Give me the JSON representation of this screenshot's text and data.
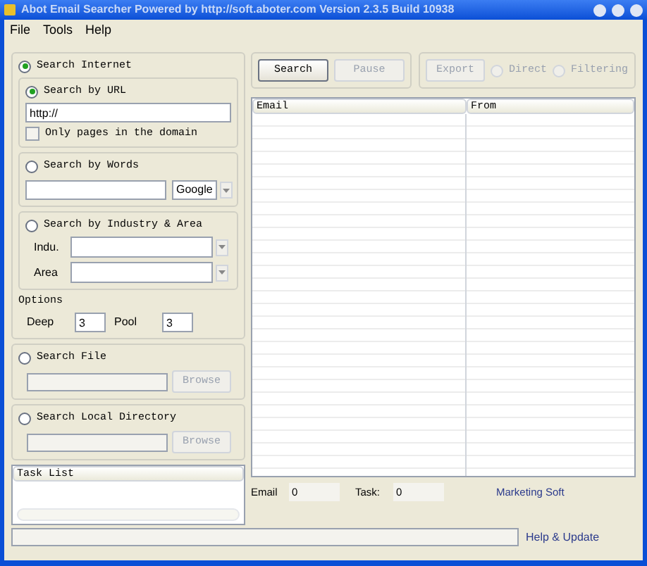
{
  "window": {
    "title": "Abot Email Searcher Powered by http://soft.aboter.com Version 2.3.5 Build 10938"
  },
  "menu": [
    "File",
    "Tools",
    "Help"
  ],
  "search_internet": {
    "label": "Search Internet",
    "selected": true
  },
  "by_url": {
    "label": "Search by URL",
    "selected": true,
    "value": "http://",
    "only_domain": {
      "label": "Only pages in the domain",
      "checked": false
    }
  },
  "by_words": {
    "label": "Search by Words",
    "selected": false,
    "engine": "Google"
  },
  "by_industry": {
    "label": "Search by Industry & Area",
    "selected": false,
    "fields": [
      {
        "label": "Indu."
      },
      {
        "label": "Area"
      }
    ]
  },
  "options": {
    "label": "Options",
    "fields": [
      {
        "label": "Deep",
        "value": "3"
      },
      {
        "label": "Pool",
        "value": "3"
      }
    ]
  },
  "search_file": {
    "label": "Search File",
    "selected": false,
    "button": {
      "label": "Browse",
      "disabled": true
    }
  },
  "local_directory": {
    "label": "Search Local Directory",
    "selected": false,
    "button": {
      "label": "Browse",
      "disabled": true
    }
  },
  "task_list": {
    "column": "Task List"
  },
  "toolbar": {
    "buttons": [
      {
        "label": "Search",
        "disabled": false
      },
      {
        "label": "Pause",
        "disabled": true
      }
    ],
    "export": {
      "label": "Export",
      "disabled": true
    },
    "modes": [
      {
        "label": "Direct",
        "selected": false,
        "disabled": true
      },
      {
        "label": "Filtering",
        "selected": false,
        "disabled": true
      }
    ]
  },
  "table": {
    "columns": [
      "Email",
      "From"
    ]
  },
  "counters": [
    {
      "label": "Email",
      "value": "0"
    },
    {
      "label": "Task:",
      "value": "0"
    }
  ],
  "progress": {
    "level": 0
  },
  "links": {
    "marketing": "Marketing Soft",
    "help": "Help & Update"
  }
}
